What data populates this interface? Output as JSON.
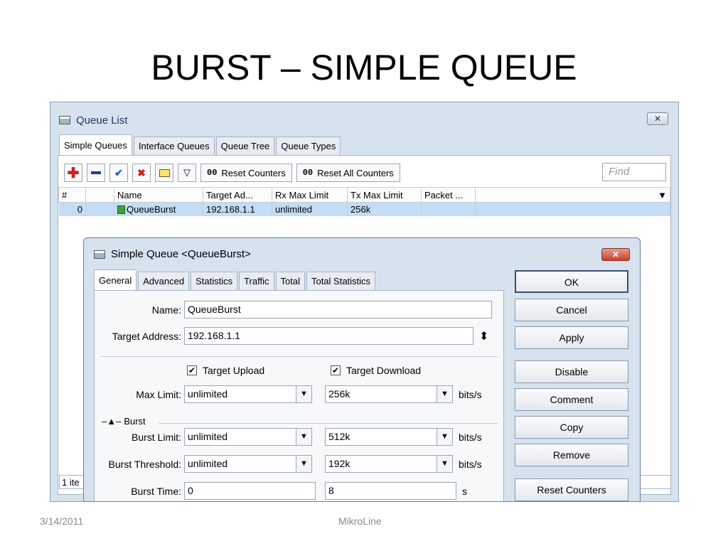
{
  "slide": {
    "title": "BURST – SIMPLE QUEUE",
    "footer_date": "3/14/2011",
    "footer_brand": "MikroLine"
  },
  "queue_list": {
    "title": "Queue List",
    "tabs": [
      "Simple Queues",
      "Interface Queues",
      "Queue Tree",
      "Queue Types"
    ],
    "toolbar": {
      "reset_counters": "Reset Counters",
      "reset_all_counters": "Reset All Counters",
      "reset_glyph": "00",
      "find_placeholder": "Find"
    },
    "columns": [
      "#",
      "",
      "Name",
      "Target Ad...",
      "Rx Max Limit",
      "Tx Max Limit",
      "Packet ..."
    ],
    "rows": [
      {
        "num": "0",
        "name": "QueueBurst",
        "target": "192.168.1.1",
        "rx": "unlimited",
        "tx": "256k",
        "packet": ""
      }
    ],
    "status": "1 ite"
  },
  "simple_queue": {
    "title": "Simple Queue <QueueBurst>",
    "tabs": [
      "General",
      "Advanced",
      "Statistics",
      "Traffic",
      "Total",
      "Total Statistics"
    ],
    "fields": {
      "name_label": "Name:",
      "name_value": "QueueBurst",
      "target_label": "Target Address:",
      "target_value": "192.168.1.1",
      "target_upload": "Target Upload",
      "target_download": "Target Download",
      "max_limit_label": "Max Limit:",
      "max_limit_up": "unlimited",
      "max_limit_down": "256k",
      "burst_section": "Burst",
      "burst_limit_label": "Burst Limit:",
      "burst_limit_up": "unlimited",
      "burst_limit_down": "512k",
      "burst_threshold_label": "Burst Threshold:",
      "burst_threshold_up": "unlimited",
      "burst_threshold_down": "192k",
      "burst_time_label": "Burst Time:",
      "burst_time_up": "0",
      "burst_time_down": "8",
      "unit_bits": "bits/s",
      "unit_s": "s"
    },
    "buttons": [
      "OK",
      "Cancel",
      "Apply",
      "Disable",
      "Comment",
      "Copy",
      "Remove",
      "Reset Counters"
    ]
  },
  "icons": {
    "add": "plus-icon",
    "remove": "minus-icon",
    "enable": "check-icon",
    "disable": "x-icon",
    "comment": "note-icon",
    "filter": "filter-icon"
  },
  "colors": {
    "add": "#d21e1e",
    "enable": "#1f5fbf",
    "disable": "#d21e1e",
    "selected_row": "#c4dcf5"
  }
}
